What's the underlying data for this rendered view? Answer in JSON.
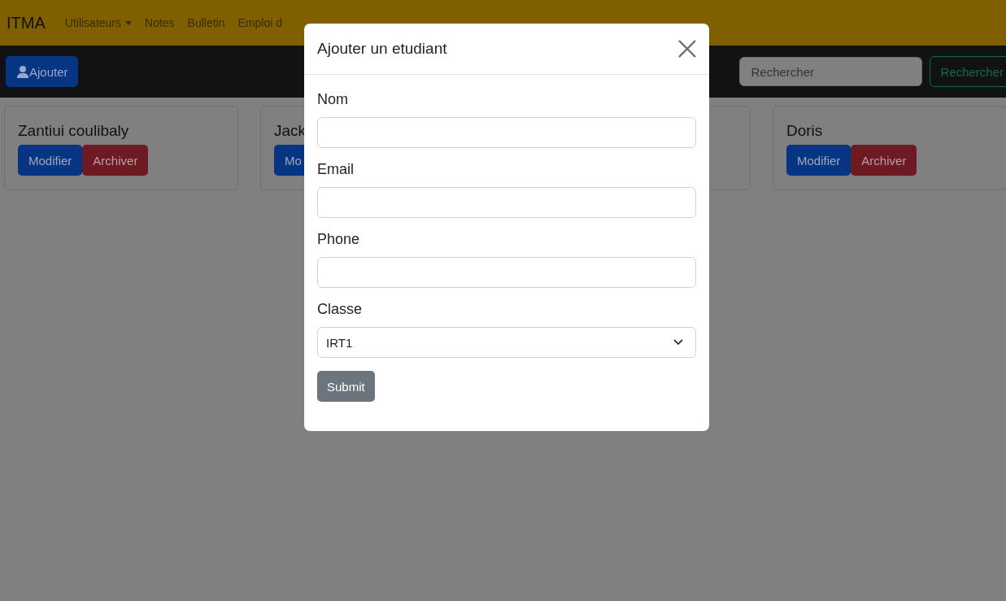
{
  "navbar": {
    "brand": "ITMA",
    "items": [
      {
        "label": "Utilisateurs",
        "dropdown": true
      },
      {
        "label": "Notes",
        "dropdown": false
      },
      {
        "label": "Bulletin",
        "dropdown": false
      },
      {
        "label": "Emploi d",
        "dropdown": false
      }
    ]
  },
  "toolbar": {
    "add_button": "Ajouter",
    "search": {
      "placeholder": "Rechercher"
    },
    "search_button": "Rechercher"
  },
  "cards": [
    {
      "kind": "student",
      "name": "Zantiui coulibaly",
      "buttons": [
        {
          "label": "Modifier",
          "kind": "edit"
        },
        {
          "label": "Archiver",
          "kind": "archive"
        }
      ]
    },
    {
      "kind": "student",
      "name": "Jack",
      "buttons": [
        {
          "label": "Mo",
          "kind": "edit"
        }
      ]
    },
    {
      "kind": "blank"
    },
    {
      "kind": "student",
      "name": "Doris",
      "buttons": [
        {
          "label": "Modifier",
          "kind": "edit"
        },
        {
          "label": "Archiver",
          "kind": "archive"
        }
      ]
    }
  ],
  "modal": {
    "title": "Ajouter un etudiant",
    "fields": [
      {
        "label": "Nom",
        "kind": "input"
      },
      {
        "label": "Email",
        "kind": "input"
      },
      {
        "label": "Phone",
        "kind": "input"
      },
      {
        "label": "Classe",
        "kind": "select",
        "value": "IRT1"
      }
    ],
    "submit": "Submit"
  }
}
